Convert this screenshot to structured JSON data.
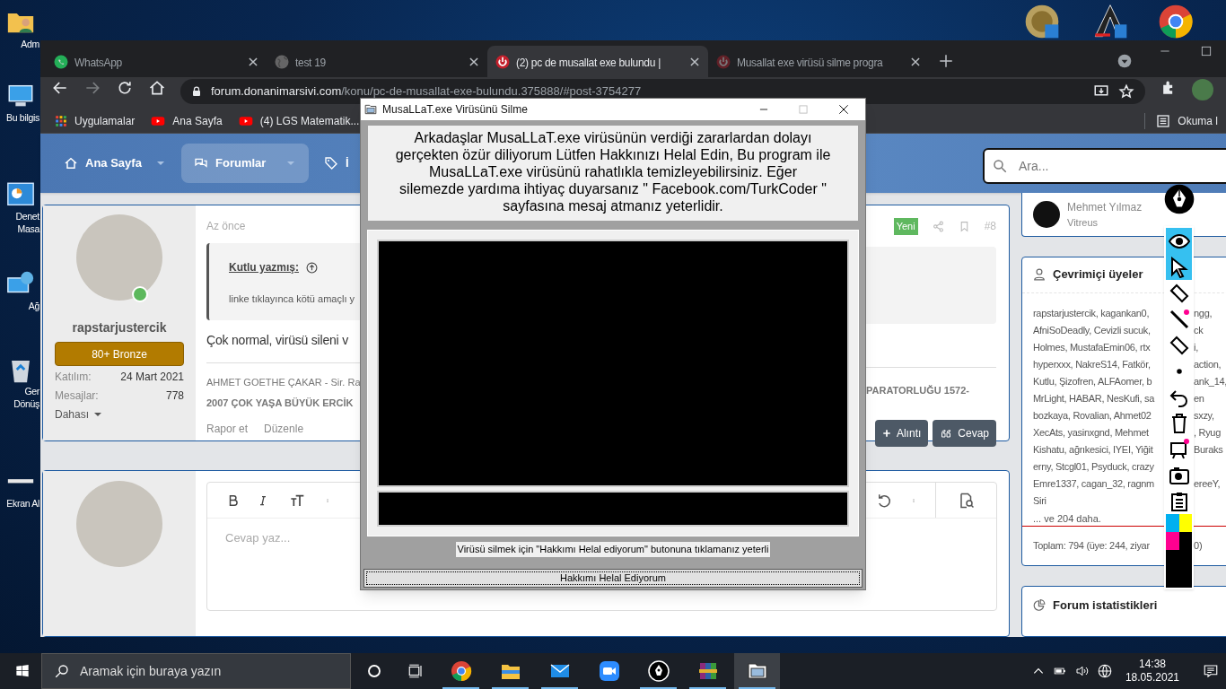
{
  "desktop_icons": [
    {
      "kind": "user-folder",
      "label": "Adm"
    },
    {
      "kind": "computer",
      "label": "Bu bilgis"
    },
    {
      "kind": "control-panel",
      "label": "Denet\nMasa"
    },
    {
      "kind": "network",
      "label": "Ağ"
    },
    {
      "kind": "recycle",
      "label": "Ger\nDönüş"
    },
    {
      "kind": "screenshot",
      "label": "Ekran Al"
    }
  ],
  "browser": {
    "tabs": [
      {
        "title": "WhatsApp",
        "kind": "whatsapp",
        "selected": false
      },
      {
        "title": "test 19",
        "kind": "globe",
        "selected": false
      },
      {
        "title": "(2) pc de musallat exe bulundu |",
        "kind": "forum",
        "selected": true
      },
      {
        "title": "Musallat exe virüsü silme progra",
        "kind": "forum",
        "selected": false
      }
    ],
    "url_host": "forum.donanimarsivi.com",
    "url_path": "/konu/pc-de-musallat-exe-bulundu.375888/#post-3754277",
    "bookmarks": [
      {
        "label": "Uygulamalar",
        "kind": "apps"
      },
      {
        "label": "Ana Sayfa",
        "kind": "youtube"
      },
      {
        "label": "(4) LGS Matematik...",
        "kind": "youtube"
      }
    ],
    "reading_list": "Okuma l"
  },
  "forum": {
    "nav": [
      {
        "label": "Ana Sayfa",
        "kind": "home",
        "selected": false,
        "dropdown": true
      },
      {
        "label": "Forumlar",
        "kind": "chat",
        "selected": true,
        "dropdown": true
      },
      {
        "label": "İ",
        "kind": "tag",
        "selected": false,
        "dropdown": false
      }
    ],
    "search_placeholder": "Ara...",
    "post": {
      "time": "Az önce",
      "badge": "Yeni",
      "number": "#8",
      "author": "rapstarjustercik",
      "rank": "80+ Bronze",
      "stats": [
        {
          "label": "Katılım:",
          "value": "24 Mart 2021"
        },
        {
          "label": "Mesajlar:",
          "value": "778"
        }
      ],
      "more": "Dahası",
      "quote_author": "Kutlu yazmış:",
      "quote_text": "linke tıklayınca kötü amaçlı y",
      "message": "Çok normal, virüsü sileni v",
      "signature_start": "AHMET GOETHE ÇAKAR - Sir. Ra",
      "signature_end": "PARATORLUĞU 1572-",
      "signature_line2": "2007 ÇOK YAŞA BÜYÜK ERCİK",
      "actions": [
        "Rapor et",
        "Düzenle"
      ],
      "buttons": [
        {
          "label": "Alıntı",
          "kind": "plus"
        },
        {
          "label": "Cevap",
          "kind": "quote"
        }
      ]
    },
    "reply": {
      "placeholder": "Cevap yaz..."
    },
    "sidebar": {
      "featured": {
        "name": "Mehmet Yılmaz",
        "title": "Vitreus"
      },
      "online": {
        "title": "Çevrimiçi üyeler",
        "lines": [
          [
            "rapstarjustercik, kagankan0,",
            "ngg,"
          ],
          [
            "AfniSoDeadly, Cevizli sucuk,",
            "ck"
          ],
          [
            "Holmes, MustafaEmin06, rtx",
            "i,"
          ],
          [
            "hyperxxx, NakreS14, Fatkör,",
            "action,"
          ],
          [
            "Kutlu, Şizofren, ALFAomer, b",
            "ank_14,"
          ],
          [
            "MrLight, HABAR, NesKufi, sa",
            "en"
          ],
          [
            "bozkaya, Rovalian, Ahmet02",
            "sxzy,"
          ],
          [
            "XecAts, yasinxgnd, Mehmet",
            ", Ryug"
          ],
          [
            "Kishatu, ağrıkesici, IYEI, Yiğit",
            "Buraks"
          ],
          [
            "erny, Stcgl01, Psyduck, crazy"
          ],
          [
            "Emre1337, cagan_32, ragnm",
            "ereeY,"
          ],
          [
            "Siri"
          ]
        ],
        "more": "... ve 204 daha.",
        "total": "Toplam: 794 (üye: 244, ziyar",
        "total_end": "0)"
      },
      "stats_title": "Forum istatistikleri"
    }
  },
  "dialog": {
    "title": "MusaLLaT.exe Virüsünü Silme",
    "message": "Arkadaşlar MusaLLaT.exe virüsünün verdiği zararlardan dolayı\ngerçekten özür diliyorum Lütfen Hakkınızı Helal Edin, Bu program ile\nMusaLLaT.exe virüsünü rahatlıkla temizleyebilirsiniz. Eğer\nsilemezde yardıma ihtiyaç duyarsanız \" Facebook.com/TurkCoder \"\nsayfasına mesaj atmanız yeterlidir.",
    "hint": "Virüsü silmek için \"Hakkımı Helal ediyorum\" butonuna tıklamanız yeterli",
    "button": "Hakkımı Helal Ediyorum"
  },
  "pen_toolbar": {
    "tools": [
      {
        "kind": "eye",
        "selected": true
      },
      {
        "kind": "cursor",
        "selected": true
      },
      {
        "kind": "highlighter",
        "selected": false
      },
      {
        "kind": "pen",
        "selected": false
      },
      {
        "kind": "eraser",
        "selected": false
      },
      {
        "kind": "dot",
        "selected": false
      },
      {
        "kind": "undo",
        "selected": false
      },
      {
        "kind": "trash",
        "selected": false
      },
      {
        "kind": "board",
        "selected": false
      },
      {
        "kind": "camera",
        "selected": false
      },
      {
        "kind": "clipboard",
        "selected": false
      }
    ],
    "colors": [
      {
        "color": "#00b0f0"
      },
      {
        "color": "#ffff00"
      },
      {
        "color": "#ff0090"
      },
      {
        "color": "#000000"
      }
    ]
  },
  "taskbar": {
    "search_placeholder": "Aramak için buraya yazın",
    "apps": [
      {
        "kind": "chrome",
        "running": true,
        "selected": false
      },
      {
        "kind": "explorer",
        "running": true,
        "selected": false
      },
      {
        "kind": "mail",
        "running": true,
        "selected": false
      },
      {
        "kind": "zoom",
        "running": false,
        "selected": false
      },
      {
        "kind": "pen",
        "running": true,
        "selected": false
      },
      {
        "kind": "winrar",
        "running": true,
        "selected": false
      },
      {
        "kind": "app",
        "running": true,
        "selected": true
      }
    ],
    "time": "14:38",
    "date": "18.05.2021"
  }
}
